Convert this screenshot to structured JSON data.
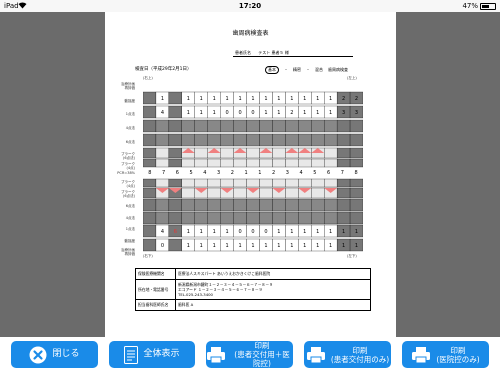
{
  "status": {
    "device": "iPad",
    "wifi": "wifi-icon",
    "time": "17:20",
    "battery_percent": "47%",
    "battery_level": 0.47
  },
  "document": {
    "title": "歯周病検査表",
    "patient_label": "患者氏名",
    "patient_name": "テスト 患者５ 様",
    "exam_date": "検査日（平成29年2月1日）",
    "legend": [
      "基本",
      "精密",
      "混合",
      "歯周病検査"
    ],
    "side_right": "(右上)",
    "side_left": "(左上)",
    "side_right_lower": "(右下)",
    "side_left_lower": "(左下)",
    "row_labels_upper": [
      "治療計画\n再評価",
      "動揺度",
      "1点法",
      "4点法",
      "6点法",
      "プラーク\n(6点法)",
      "プラーク\n(4点)"
    ],
    "pcr_label": "PCR=38%",
    "tooth_numbers_upper": [
      "8",
      "7",
      "6",
      "5",
      "4",
      "3",
      "2",
      "1",
      "1",
      "2",
      "3",
      "4",
      "5",
      "6",
      "7",
      "8"
    ],
    "tooth_numbers_lower": [
      "8",
      "7",
      "6",
      "5",
      "4",
      "3",
      "2",
      "1",
      "1",
      "2",
      "3",
      "4",
      "5",
      "6",
      "7",
      "8"
    ],
    "mobility_upper": [
      "",
      "1",
      "",
      "1",
      "1",
      "1",
      "1",
      "1",
      "1",
      "1",
      "1",
      "1",
      "1",
      "1",
      "1",
      "2",
      "2"
    ],
    "onepoint_upper": [
      "",
      "4",
      "",
      "1",
      "1",
      "1",
      "0",
      "0",
      "0",
      "1",
      "1",
      "2",
      "1",
      "1",
      "1",
      "3",
      "3"
    ],
    "onepoint_lower": [
      "",
      "4",
      "6",
      "1",
      "1",
      "1",
      "1",
      "0",
      "0",
      "0",
      "1",
      "1",
      "1",
      "1",
      "1",
      "1",
      "1"
    ],
    "mobility_lower": [
      "",
      "0",
      "",
      "1",
      "1",
      "1",
      "1",
      "1",
      "1",
      "1",
      "1",
      "1",
      "1",
      "1",
      "1",
      "1",
      "1"
    ],
    "info": [
      {
        "key": "保険医療機関名",
        "value": "医療法人スキスパート あいうえおかきくけこ歯科医院"
      },
      {
        "key": "所在地・電話番号",
        "value": "新潟県新潟市鍵町１－２－３－４－５－６－７－８－９\nエコアード １－２－３－４－５－６－７－８－９\nTEL.025-243-3400"
      },
      {
        "key": "担当歯科医師氏名",
        "value": "歯科医 A"
      }
    ]
  },
  "toolbar": {
    "close": "閉じる",
    "full_view": "全体表示",
    "print_patient_clinic": "印刷\n(患者交付用＋医院控)",
    "print_patient": "印刷\n(患者交付用のみ)",
    "print_clinic": "印刷\n(医院控のみ)"
  }
}
